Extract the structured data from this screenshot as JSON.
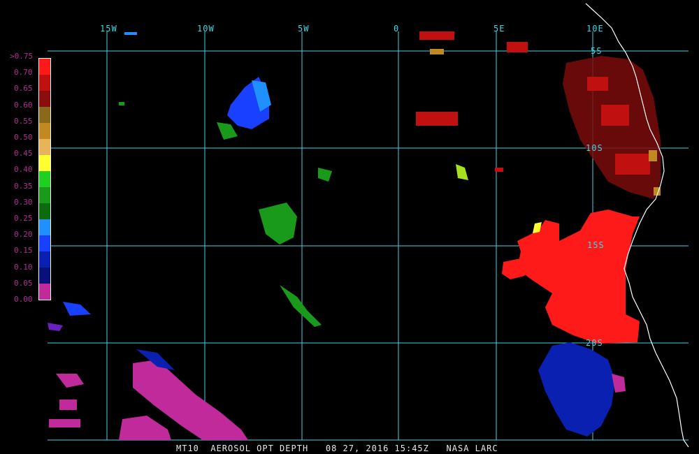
{
  "title": "MT10  AEROSOL OPT DEPTH   08 27, 2016 15:45Z   NASA LARC",
  "grid": {
    "longitudes": [
      "15W",
      "10W",
      "5W",
      "0",
      "5E",
      "10E"
    ],
    "latitudes": [
      "5S",
      "10S",
      "15S",
      "20S"
    ],
    "color": "#3fd6e6"
  },
  "legend": {
    "labels": [
      ">0.75",
      "0.70",
      "0.65",
      "0.60",
      "0.55",
      "0.50",
      "0.45",
      "0.40",
      "0.35",
      "0.30",
      "0.25",
      "0.20",
      "0.15",
      "0.10",
      "0.05",
      "0.00"
    ],
    "colors": [
      "#ff1a1a",
      "#c01010",
      "#8a0e0e",
      "#8a6a1a",
      "#c08a20",
      "#e8b45a",
      "#ffff30",
      "#20d020",
      "#1a9a1a",
      "#0e6a0e",
      "#2090ff",
      "#1a40ff",
      "#0a20b0",
      "#0a107a",
      "#c02a9a"
    ],
    "label_color": "#b0308f"
  },
  "colors": {
    "coast": "#ffffff",
    "background": "#000000"
  }
}
